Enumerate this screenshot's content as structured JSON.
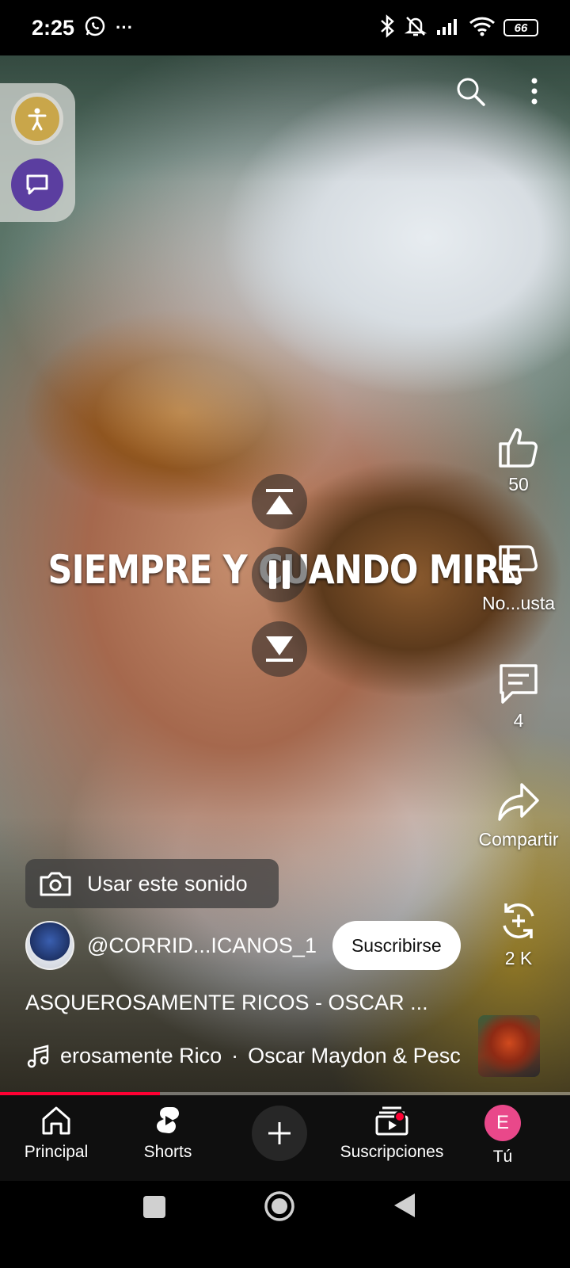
{
  "status_bar": {
    "time": "2:25",
    "more": "···",
    "battery": "66"
  },
  "video": {
    "caption": "SIEMPRE Y CUANDO MIRE",
    "progress_fraction": 0.28
  },
  "actions": {
    "like_count": "50",
    "dislike_label": "No...usta",
    "comment_count": "4",
    "share_label": "Compartir",
    "remix_count": "2 K"
  },
  "use_sound": "Usar este sonido",
  "channel": {
    "handle": "@CORRID...ICANOS_1",
    "subscribe_label": "Suscribirse"
  },
  "video_title": "ASQUEROSAMENTE RICOS - OSCAR  ...",
  "music": {
    "song": "erosamente Rico",
    "separator": "·",
    "artist": "Oscar Maydon & Pesc"
  },
  "nav": {
    "home": "Principal",
    "shorts": "Shorts",
    "subscriptions": "Suscripciones",
    "you": "Tú",
    "you_initial": "E"
  },
  "colors": {
    "accent_red": "#ff0033",
    "avatar_pink": "#e9488a",
    "nav_bg": "#0f0f0f"
  }
}
